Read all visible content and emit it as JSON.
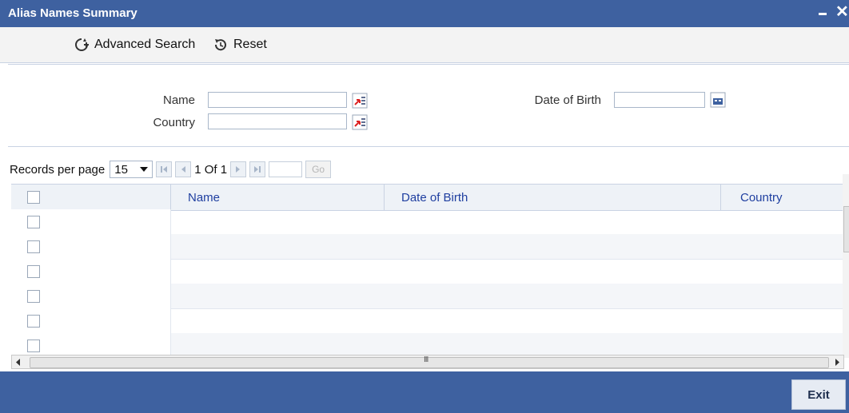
{
  "window": {
    "title": "Alias Names Summary",
    "minimize_label": "–",
    "close_label": "✕"
  },
  "toolbar": {
    "advanced_search_label": "Advanced Search",
    "reset_label": "Reset"
  },
  "search_form": {
    "name_label": "Name",
    "name_value": "",
    "country_label": "Country",
    "country_value": "",
    "dob_label": "Date of Birth",
    "dob_value": ""
  },
  "pager": {
    "records_per_page_label": "Records per page",
    "records_per_page_value": "15",
    "page_status": "1 Of 1",
    "goto_value": "",
    "go_label": "Go"
  },
  "table": {
    "columns": [
      "Name",
      "Date of Birth",
      "Country"
    ],
    "rows": [
      {
        "name": "",
        "dob": "",
        "country": ""
      },
      {
        "name": "",
        "dob": "",
        "country": ""
      },
      {
        "name": "",
        "dob": "",
        "country": ""
      },
      {
        "name": "",
        "dob": "",
        "country": ""
      },
      {
        "name": "",
        "dob": "",
        "country": ""
      },
      {
        "name": "",
        "dob": "",
        "country": ""
      }
    ],
    "scroll_marker": "III"
  },
  "footer": {
    "exit_label": "Exit"
  },
  "colors": {
    "titlebar": "#3e61a0",
    "header_text": "#1f3fa0"
  },
  "icons": {
    "advanced_search": "advanced-search-icon",
    "reset": "reset-icon",
    "lov": "list-of-values-icon",
    "calendar": "calendar-icon"
  }
}
